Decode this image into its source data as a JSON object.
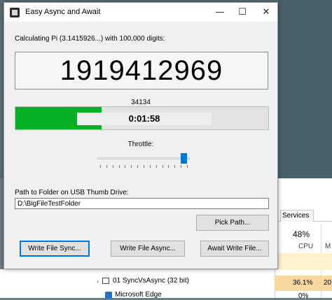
{
  "window": {
    "title": "Easy Async and Await",
    "controls": {
      "minimize": "—",
      "maximize": "☐",
      "close": "✕"
    }
  },
  "calc": {
    "label": "Calculating Pi (3.1415926...) with 100,000 digits:",
    "display": "1919412969"
  },
  "progress": {
    "counter": "34134",
    "fraction": 0.34134,
    "elapsed": "0:01:58",
    "color": "#06b025"
  },
  "throttle": {
    "label": "Throttle:",
    "level": 0.93,
    "tick_count": 15
  },
  "path": {
    "label": "Path to Folder on USB Thumb Drive:",
    "value": "D:\\BigFileTestFolder"
  },
  "buttons": {
    "pick": "Pick Path...",
    "write_sync": "Write File Sync...",
    "write_async": "Write File Async...",
    "await_write": "Await Write File..."
  },
  "task_manager": {
    "tab": "Services",
    "cpu_percent": "48%",
    "cpu_label": "CPU",
    "m_label": "M",
    "process1_name": "01 SyncVsAsync (32 bit)",
    "process1_cpu": "36.1%",
    "process1_mem": "20",
    "process2_name": "Microsoft Edge",
    "process2_cpu": "0%"
  }
}
